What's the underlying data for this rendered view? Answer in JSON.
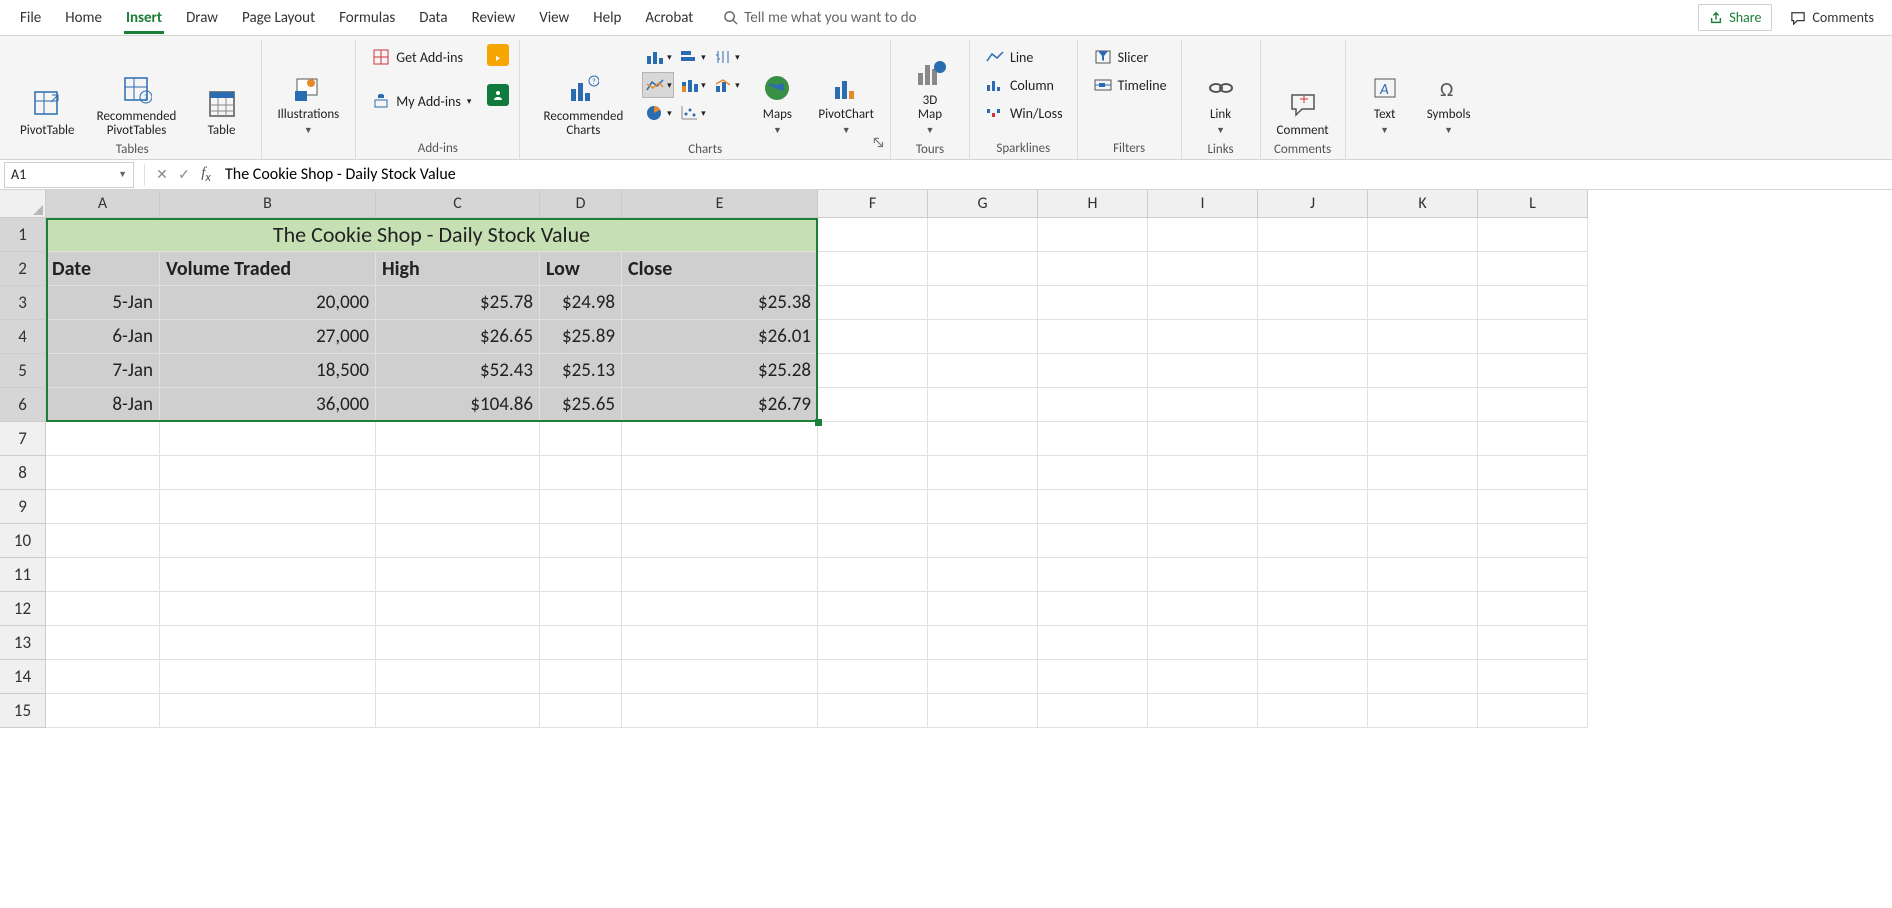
{
  "tabs": {
    "file": "File",
    "home": "Home",
    "insert": "Insert",
    "draw": "Draw",
    "pagelayout": "Page Layout",
    "formulas": "Formulas",
    "data": "Data",
    "review": "Review",
    "view": "View",
    "help": "Help",
    "acrobat": "Acrobat"
  },
  "search_placeholder": "Tell me what you want to do",
  "share": "Share",
  "comments": "Comments",
  "ribbon": {
    "pivottable": "PivotTable",
    "recpivot": "Recommended\nPivotTables",
    "table": "Table",
    "tables_label": "Tables",
    "illustrations": "Illustrations",
    "getaddins": "Get Add-ins",
    "myaddins": "My Add-ins",
    "addins_label": "Add-ins",
    "reccharts": "Recommended\nCharts",
    "maps": "Maps",
    "pivotchart": "PivotChart",
    "charts_label": "Charts",
    "map3d": "3D\nMap",
    "tours_label": "Tours",
    "line": "Line",
    "column": "Column",
    "winloss": "Win/Loss",
    "sparklines_label": "Sparklines",
    "slicer": "Slicer",
    "timeline": "Timeline",
    "filters_label": "Filters",
    "link": "Link",
    "links_label": "Links",
    "comment": "Comment",
    "comments_label": "Comments",
    "text": "Text",
    "symbols": "Symbols"
  },
  "namebox": "A1",
  "formula": "The Cookie Shop - Daily Stock Value",
  "columns": [
    "A",
    "B",
    "C",
    "D",
    "E",
    "F",
    "G",
    "H",
    "I",
    "J",
    "K",
    "L"
  ],
  "sheet": {
    "title": "The Cookie Shop - Daily Stock Value",
    "headers": {
      "date": "Date",
      "vol": "Volume Traded",
      "high": "High",
      "low": "Low",
      "close": "Close"
    },
    "rows": [
      {
        "date": "5-Jan",
        "vol": "20,000",
        "high": "$25.78",
        "low": "$24.98",
        "close": "$25.38"
      },
      {
        "date": "6-Jan",
        "vol": "27,000",
        "high": "$26.65",
        "low": "$25.89",
        "close": "$26.01"
      },
      {
        "date": "7-Jan",
        "vol": "18,500",
        "high": "$52.43",
        "low": "$25.13",
        "close": "$25.28"
      },
      {
        "date": "8-Jan",
        "vol": "36,000",
        "high": "$104.86",
        "low": "$25.65",
        "close": "$26.79"
      }
    ]
  }
}
